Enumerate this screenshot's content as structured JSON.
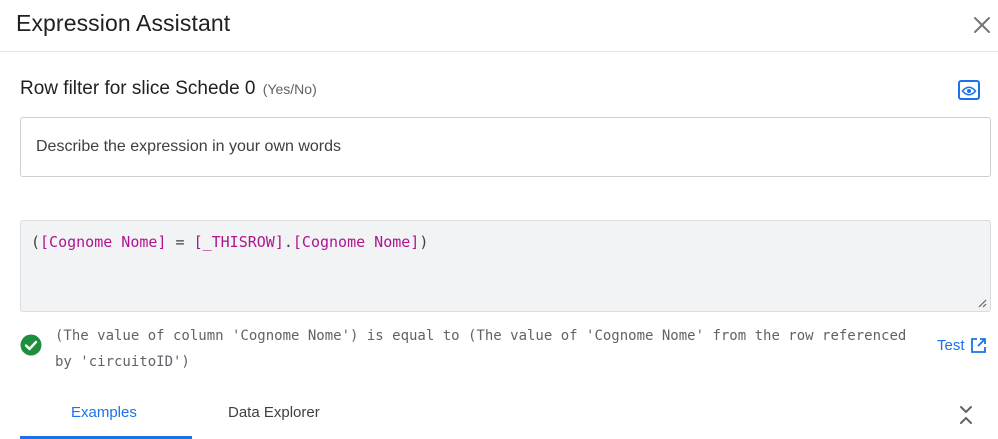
{
  "dialog": {
    "title": "Expression Assistant",
    "close_icon": "close-icon"
  },
  "field": {
    "label": "Row filter for slice Schede 0",
    "type": "(Yes/No)",
    "preview_icon": "eye-preview-icon"
  },
  "describe": {
    "placeholder": "Describe the expression in your own words",
    "value": ""
  },
  "expression": {
    "tokens": [
      {
        "text": "(",
        "kind": "punct"
      },
      {
        "text": "[Cognome Nome]",
        "kind": "column"
      },
      {
        "text": " = ",
        "kind": "punct"
      },
      {
        "text": "[_THISROW]",
        "kind": "column"
      },
      {
        "text": ".",
        "kind": "punct"
      },
      {
        "text": "[Cognome Nome]",
        "kind": "column"
      },
      {
        "text": ")",
        "kind": "punct"
      }
    ]
  },
  "status": {
    "icon": "check-circle-icon",
    "color": "#1e8e3e",
    "explanation": "(The value of column 'Cognome Nome') is equal to (The value of 'Cognome Nome' from the row referenced by 'circuitoID')"
  },
  "test": {
    "label": "Test",
    "icon": "open-in-new-icon"
  },
  "tabs": [
    {
      "label": "Examples",
      "active": true
    },
    {
      "label": "Data Explorer",
      "active": false
    }
  ],
  "collapse_icon": "collapse-chevrons-icon",
  "colors": {
    "accent": "#1a73e8",
    "column_token": "#b0158e",
    "success": "#1e8e3e"
  }
}
